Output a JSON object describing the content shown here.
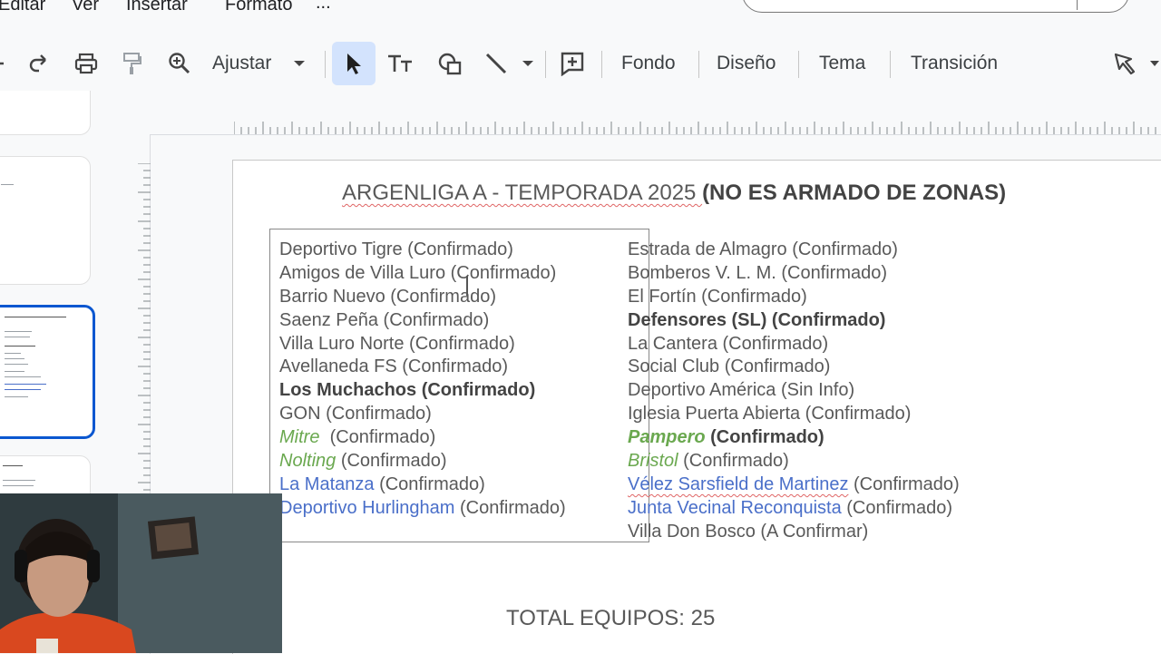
{
  "menu": {
    "items": [
      "Editar",
      "Ver",
      "Insertar",
      "Formato",
      "..."
    ]
  },
  "toolbar": {
    "zoom_label": "Ajustar",
    "buttons": [
      "Fondo",
      "Diseño",
      "Tema",
      "Transición"
    ]
  },
  "slide": {
    "title_normal": "ARGENLIGA A - TEMPORADA 2025 ",
    "title_bold": "(NO ES ARMADO DE ZONAS)",
    "left_column": [
      "Deportivo Tigre (Confirmado)",
      "Amigos de Villa Luro (Confirmado)",
      "Barrio Nuevo (Confirmado)",
      "Saenz Peña  (Confirmado)",
      "Villa Luro Norte (Confirmado)",
      "Avellaneda FS (Confirmado)",
      "Los Muchachos (Confirmado)",
      "GON (Confirmado)",
      {
        "team": "Mitre",
        "status": "  (Confirmado)"
      },
      {
        "team": "Nolting",
        "status": " (Confirmado)"
      },
      {
        "team": "La Matanza",
        "status": " (Confirmado)"
      },
      {
        "team": "Deportivo Hurlingham",
        "status": " (Confirmado)"
      }
    ],
    "right_column": [
      "Estrada de Almagro (Confirmado)",
      "Bomberos V. L. M. (Confirmado)",
      "El Fortín (Confirmado)",
      "Defensores (SL) (Confirmado)",
      "La Cantera (Confirmado)",
      "Social Club (Confirmado)",
      "Deportivo América (Sin Info)",
      "Iglesia Puerta Abierta (Confirmado)",
      {
        "team": "Pampero",
        "status": " (Confirmado)"
      },
      {
        "team": "Bristol",
        "status": " (Confirmado)"
      },
      {
        "team": "Vélez Sarsfield de Martinez",
        "status": " (Confirmado)"
      },
      {
        "team": "Junta Vecinal Reconquista",
        "status": " (Confirmado)"
      },
      "Villa Don Bosco (A Confirmar)"
    ],
    "total": "TOTAL EQUIPOS: 25"
  },
  "colors": {
    "accent": "#0b57d0",
    "green_team": "#6aa84f",
    "blue_team": "#4a6fc9"
  }
}
